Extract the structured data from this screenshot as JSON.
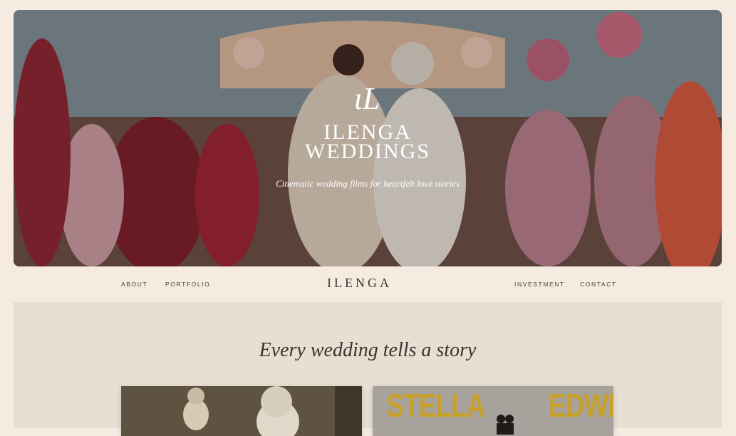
{
  "hero": {
    "monogram": "ɩL",
    "title_line1": "ILENGA",
    "title_line2": "WEDDINGS",
    "subtitle": "Cinematic wedding films for heartfelt love stories"
  },
  "nav": {
    "about": "ABOUT",
    "portfolio": "PORTFOLIO",
    "brand": "ILENGA",
    "investment": "INVESTMENT",
    "contact": "CONTACT"
  },
  "intro": {
    "tagline": "Every wedding tells a story"
  },
  "cards": {
    "card2_left_word": "STELLA",
    "card2_right_word": "EDWIN"
  },
  "colors": {
    "page_background": "#f5ebe0",
    "panel_background": "#e8dfd3",
    "accent_gold": "#c7a12a"
  }
}
